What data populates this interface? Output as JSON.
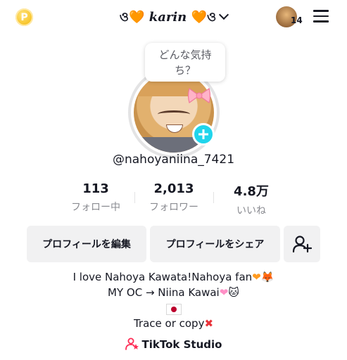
{
  "top_bar": {
    "coin_glyph": "P",
    "username_prefix": "ও🧡 ",
    "username": "karin",
    "username_suffix": " 🧡ও",
    "friend_count": "14"
  },
  "profile": {
    "bubble_text": "どんな気持ち？",
    "handle": "@nahoyaniina_7421"
  },
  "stats": [
    {
      "value": "113",
      "label": "フォロー中"
    },
    {
      "value": "2,013",
      "label": "フォロワー"
    },
    {
      "value": "4.8万",
      "label": "いいね"
    }
  ],
  "actions": {
    "edit_label": "プロフィールを編集",
    "share_label": "プロフィールをシェア"
  },
  "bio": {
    "line1": "I love Nahoya Kawata!Nahoya fan",
    "line2": "MY OC → Niina Kawai",
    "line4": "Trace or copy"
  },
  "studio_label": "TikTok Studio",
  "colors": {
    "accent": "#20d5ec",
    "studio_icon": "#fe2c55"
  }
}
